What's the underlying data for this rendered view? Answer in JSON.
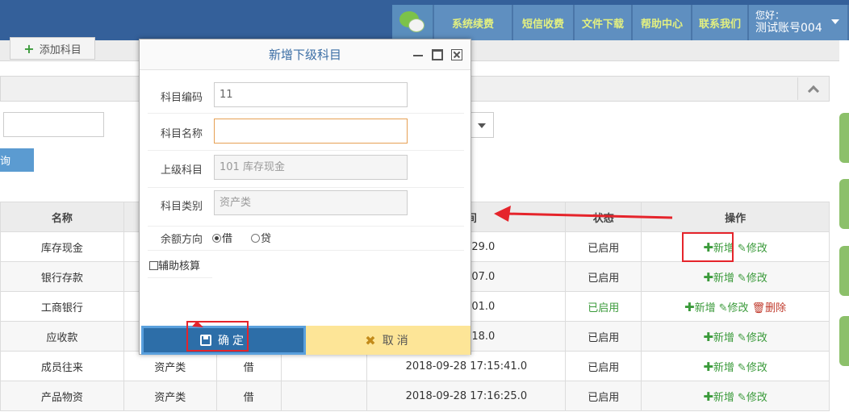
{
  "topnav": {
    "items": [
      "系统续费",
      "短信收费",
      "文件下载",
      "帮助中心",
      "联系我们"
    ],
    "greeting": "您好：",
    "account": "测试账号004"
  },
  "toolbar": {
    "add_subject": "添加科目"
  },
  "search": {
    "query_button": "询"
  },
  "table": {
    "headers": [
      "名称",
      "",
      "",
      "",
      "时间",
      "状态",
      "操作"
    ],
    "rows": [
      {
        "name": "库存现金",
        "type": "",
        "dir": "",
        "time": "16:35:29.0",
        "status": "已启用",
        "ops": [
          "新增",
          "修改"
        ]
      },
      {
        "name": "银行存款",
        "type": "",
        "dir": "",
        "time": "16:55:07.0",
        "status": "已启用",
        "ops": [
          "新增",
          "修改"
        ]
      },
      {
        "name": "工商银行",
        "type": "",
        "dir": "",
        "time": "17:09:01.0",
        "status": "已启用",
        "ops": [
          "新增",
          "修改",
          "删除"
        ]
      },
      {
        "name": "应收款",
        "type": "",
        "dir": "",
        "time": "17:14:18.0",
        "status": "已启用",
        "ops": [
          "新增",
          "修改"
        ]
      },
      {
        "name": "成员往来",
        "type": "资产类",
        "dir": "借",
        "time": "2018-09-28 17:15:41.0",
        "status": "已启用",
        "ops": [
          "新增",
          "修改"
        ]
      },
      {
        "name": "产品物资",
        "type": "资产类",
        "dir": "借",
        "time": "2018-09-28 17:16:25.0",
        "status": "已启用",
        "ops": [
          "新增",
          "修改"
        ]
      }
    ]
  },
  "modal": {
    "title": "新增下级科目",
    "fields": {
      "code_label": "科目编码",
      "code_value": "11",
      "name_label": "科目名称",
      "name_value": "",
      "parent_label": "上级科目",
      "parent_value": "101 库存现金",
      "category_label": "科目类别",
      "category_placeholder": "资产类",
      "balance_label": "余额方向",
      "debit": "借",
      "credit": "贷",
      "aux_label": "辅助核算"
    },
    "confirm": "确定",
    "cancel": "取消"
  },
  "colors": {
    "topbar": "#34609a",
    "nav": "#5f8fc0",
    "accent_red": "#e5242b",
    "confirm": "#2d6ea8",
    "cancel": "#fde597"
  }
}
